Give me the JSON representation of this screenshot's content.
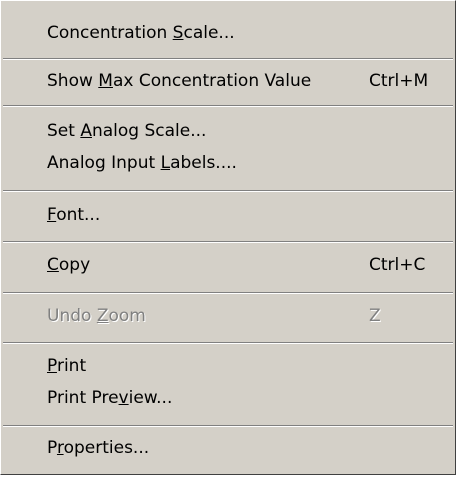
{
  "menu": {
    "items": [
      {
        "id": "concentration-scale",
        "pre": "Concentration ",
        "mn": "S",
        "post": "cale...",
        "accel": "",
        "enabled": true
      },
      {
        "id": "show-max-concentration",
        "pre": "Show ",
        "mn": "M",
        "post": "ax Concentration Value",
        "accel": "Ctrl+M",
        "enabled": true
      },
      {
        "id": "set-analog-scale",
        "pre": "Set ",
        "mn": "A",
        "post": "nalog Scale...",
        "accel": "",
        "enabled": true
      },
      {
        "id": "analog-input-labels",
        "pre": "Analog Input ",
        "mn": "L",
        "post": "abels....",
        "accel": "",
        "enabled": true
      },
      {
        "id": "font",
        "pre": "",
        "mn": "F",
        "post": "ont...",
        "accel": "",
        "enabled": true
      },
      {
        "id": "copy",
        "pre": "",
        "mn": "C",
        "post": "opy",
        "accel": "Ctrl+C",
        "enabled": true
      },
      {
        "id": "undo-zoom",
        "pre": "Undo ",
        "mn": "Z",
        "post": "oom",
        "accel": "Z",
        "enabled": false
      },
      {
        "id": "print",
        "pre": "",
        "mn": "P",
        "post": "rint",
        "accel": "",
        "enabled": true
      },
      {
        "id": "print-preview",
        "pre": "Print Pre",
        "mn": "v",
        "post": "iew...",
        "accel": "",
        "enabled": true
      },
      {
        "id": "properties",
        "pre": "P",
        "mn": "r",
        "post": "operties...",
        "accel": "",
        "enabled": true
      }
    ]
  }
}
